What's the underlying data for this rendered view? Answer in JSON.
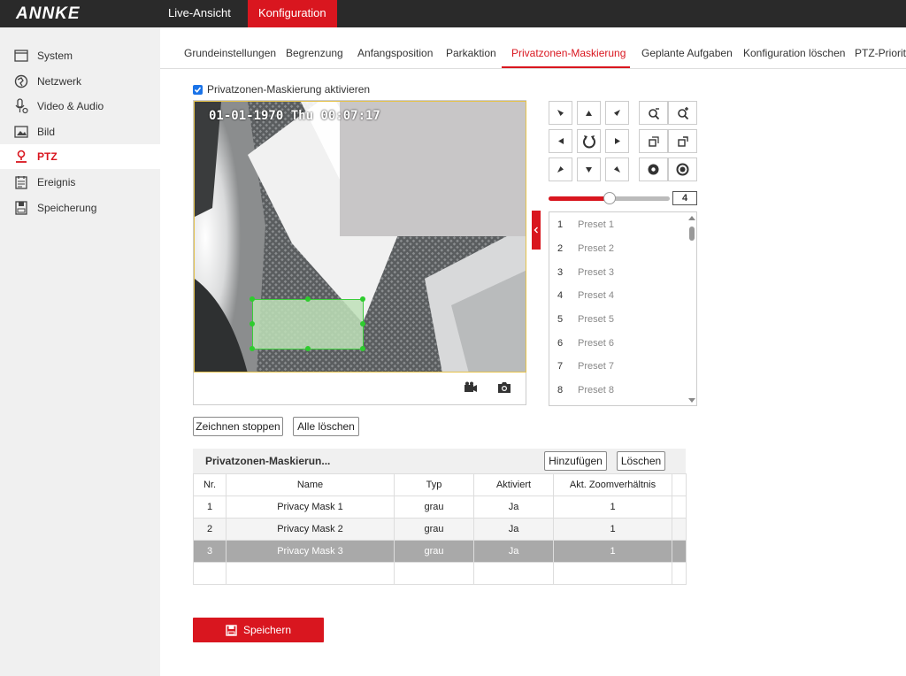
{
  "app": {
    "logo": "ANNKE"
  },
  "topnav": {
    "live": "Live-Ansicht",
    "config": "Konfiguration"
  },
  "sidebar": {
    "items": [
      {
        "label": "System",
        "icon": "system-icon"
      },
      {
        "label": "Netzwerk",
        "icon": "network-icon"
      },
      {
        "label": "Video & Audio",
        "icon": "video-audio-icon"
      },
      {
        "label": "Bild",
        "icon": "image-icon"
      },
      {
        "label": "PTZ",
        "icon": "ptz-icon",
        "active": true
      },
      {
        "label": "Ereignis",
        "icon": "event-icon"
      },
      {
        "label": "Speicherung",
        "icon": "storage-icon"
      }
    ]
  },
  "tabs": [
    {
      "label": "Grundeinstellungen"
    },
    {
      "label": "Begrenzung"
    },
    {
      "label": "Anfangsposition"
    },
    {
      "label": "Parkaktion"
    },
    {
      "label": "Privatzonen-Maskierung",
      "active": true
    },
    {
      "label": "Geplante Aufgaben"
    },
    {
      "label": "Konfiguration löschen"
    },
    {
      "label": "PTZ-Priorität"
    }
  ],
  "enable": {
    "label": "Privatzonen-Maskierung aktivieren",
    "checked": true
  },
  "video": {
    "osd": "01-01-1970 Thu 00:07:17"
  },
  "ptz": {
    "speed": "4",
    "speed_fraction": 0.5
  },
  "presets": [
    {
      "num": "1",
      "name": "Preset 1"
    },
    {
      "num": "2",
      "name": "Preset 2"
    },
    {
      "num": "3",
      "name": "Preset 3"
    },
    {
      "num": "4",
      "name": "Preset 4"
    },
    {
      "num": "5",
      "name": "Preset 5"
    },
    {
      "num": "6",
      "name": "Preset 6"
    },
    {
      "num": "7",
      "name": "Preset 7"
    },
    {
      "num": "8",
      "name": "Preset 8"
    }
  ],
  "buttons": {
    "stop_draw": "Zeichnen stoppen",
    "clear_all": "Alle löschen",
    "add": "Hinzufügen",
    "delete": "Löschen",
    "save": "Speichern"
  },
  "table": {
    "title": "Privatzonen-Maskierun...",
    "headers": [
      "Nr.",
      "Name",
      "Typ",
      "Aktiviert",
      "Akt. Zoomverhältnis"
    ],
    "rows": [
      [
        "1",
        "Privacy Mask 1",
        "grau",
        "Ja",
        "1"
      ],
      [
        "2",
        "Privacy Mask 2",
        "grau",
        "Ja",
        "1"
      ],
      [
        "3",
        "Privacy Mask 3",
        "grau",
        "Ja",
        "1"
      ]
    ],
    "selected_row": 2
  },
  "colors": {
    "accent": "#d9161f",
    "topbar": "#2a2a2a",
    "checkbox": "#1a73e8",
    "mask_edge": "#3ccd3c"
  }
}
